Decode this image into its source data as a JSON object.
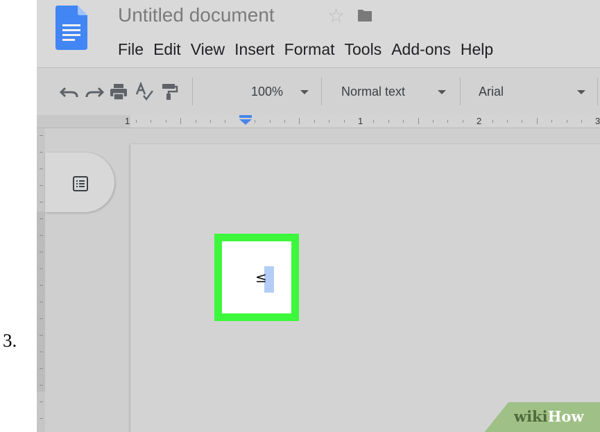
{
  "step": {
    "number": "3."
  },
  "header": {
    "title": "Untitled document",
    "menu": [
      "File",
      "Edit",
      "View",
      "Insert",
      "Format",
      "Tools",
      "Add-ons",
      "Help"
    ]
  },
  "toolbar": {
    "zoom": "100%",
    "style": "Normal text",
    "font": "Arial"
  },
  "ruler": {
    "numbers": [
      "1",
      "1",
      "2",
      "3"
    ]
  },
  "document": {
    "symbol": "≤"
  },
  "watermark": {
    "prefix": "wiki",
    "suffix": "How"
  },
  "colors": {
    "highlight": "#3df73d",
    "docs_blue": "#4285f4",
    "selection": "#b3cdf7"
  }
}
